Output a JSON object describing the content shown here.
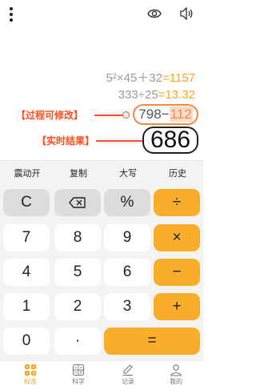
{
  "toolbar": {
    "menu_icon": "more-vertical-icon",
    "eye_icon": "eye-icon",
    "speaker_icon": "speaker-icon"
  },
  "display": {
    "history": [
      {
        "expr": "5²×45＋32",
        "result": "=1157"
      },
      {
        "expr": "333÷25",
        "result": "=13.32"
      }
    ],
    "annotation_expr": "【过程可修改】",
    "annotation_result": "【实时结果】",
    "current_expr_main": "798−",
    "current_expr_selected": "112",
    "current_result": "686"
  },
  "function_row": [
    "震动开",
    "复制",
    "大写",
    "历史"
  ],
  "keys": {
    "clear": "C",
    "backspace_icon": "backspace-icon",
    "percent": "%",
    "divide": "÷",
    "seven": "7",
    "eight": "8",
    "nine": "9",
    "multiply": "×",
    "four": "4",
    "five": "5",
    "six": "6",
    "minus": "−",
    "one": "1",
    "two": "2",
    "three": "3",
    "plus": "+",
    "zero": "0",
    "dot": "·",
    "equals": "="
  },
  "tabs": [
    {
      "label": "标准",
      "icon": "standard-calc-icon",
      "active": true
    },
    {
      "label": "科学",
      "icon": "scientific-calc-icon",
      "active": false
    },
    {
      "label": "记录",
      "icon": "edit-record-icon",
      "active": false
    },
    {
      "label": "我的",
      "icon": "user-icon",
      "active": false
    }
  ],
  "colors": {
    "accent": "#f9ae2b",
    "annotation": "#ff4d1f",
    "result_highlight": "#f6a623"
  }
}
